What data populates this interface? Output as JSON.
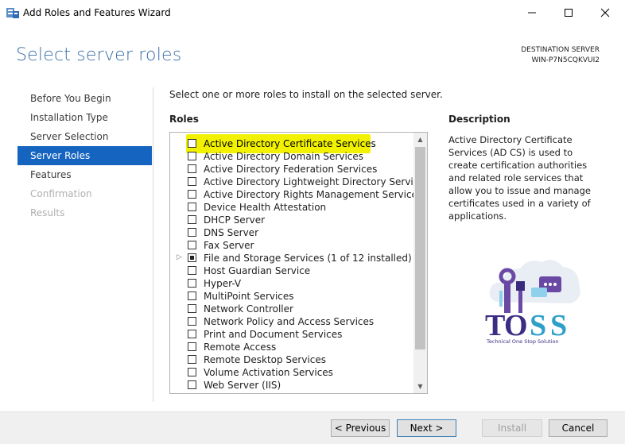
{
  "window": {
    "title": "Add Roles and Features Wizard",
    "minimize_glyph": "—",
    "maximize_glyph": "☐",
    "close_glyph": "✕"
  },
  "header": {
    "page_title": "Select server roles",
    "destination_label": "DESTINATION SERVER",
    "destination_server": "WIN-P7N5CQKVUI2"
  },
  "nav": {
    "items": [
      {
        "label": "Before You Begin",
        "state": "normal"
      },
      {
        "label": "Installation Type",
        "state": "normal"
      },
      {
        "label": "Server Selection",
        "state": "normal"
      },
      {
        "label": "Server Roles",
        "state": "active"
      },
      {
        "label": "Features",
        "state": "normal"
      },
      {
        "label": "Confirmation",
        "state": "disabled"
      },
      {
        "label": "Results",
        "state": "disabled"
      }
    ]
  },
  "content": {
    "instruction": "Select one or more roles to install on the selected server.",
    "roles_heading": "Roles",
    "roles": [
      {
        "label": "Active Directory Certificate Services",
        "state": "unchecked",
        "highlight": true
      },
      {
        "label": "Active Directory Domain Services",
        "state": "unchecked"
      },
      {
        "label": "Active Directory Federation Services",
        "state": "unchecked"
      },
      {
        "label": "Active Directory Lightweight Directory Services",
        "state": "unchecked"
      },
      {
        "label": "Active Directory Rights Management Services",
        "state": "unchecked"
      },
      {
        "label": "Device Health Attestation",
        "state": "unchecked"
      },
      {
        "label": "DHCP Server",
        "state": "unchecked"
      },
      {
        "label": "DNS Server",
        "state": "unchecked"
      },
      {
        "label": "Fax Server",
        "state": "unchecked"
      },
      {
        "label": "File and Storage Services (1 of 12 installed)",
        "state": "partial",
        "expandable": true
      },
      {
        "label": "Host Guardian Service",
        "state": "unchecked"
      },
      {
        "label": "Hyper-V",
        "state": "unchecked"
      },
      {
        "label": "MultiPoint Services",
        "state": "unchecked"
      },
      {
        "label": "Network Controller",
        "state": "unchecked"
      },
      {
        "label": "Network Policy and Access Services",
        "state": "unchecked"
      },
      {
        "label": "Print and Document Services",
        "state": "unchecked"
      },
      {
        "label": "Remote Access",
        "state": "unchecked"
      },
      {
        "label": "Remote Desktop Services",
        "state": "unchecked"
      },
      {
        "label": "Volume Activation Services",
        "state": "unchecked"
      },
      {
        "label": "Web Server (IIS)",
        "state": "unchecked"
      }
    ],
    "expander_glyph": "▷",
    "scroll_up_glyph": "▲",
    "scroll_down_glyph": "▼",
    "description_heading": "Description",
    "description_text": "Active Directory Certificate Services (AD CS) is used to create certification authorities and related role services that allow you to issue and manage certificates used in a variety of applications."
  },
  "logo": {
    "brand": "TOSS",
    "tagline": "Technical One Stop Solution"
  },
  "footer": {
    "previous_label": "< Previous",
    "next_label": "Next >",
    "install_label": "Install",
    "cancel_label": "Cancel"
  },
  "colors": {
    "accent": "#1565c0",
    "title_blue": "#3a6fa7",
    "highlight_yellow": "#f2f200"
  }
}
